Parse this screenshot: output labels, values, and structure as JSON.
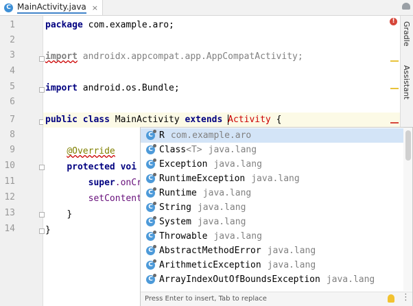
{
  "tab": {
    "icon_letter": "C",
    "name": "MainActivity.java",
    "close": "×"
  },
  "line_numbers": [
    "1",
    "2",
    "3",
    "4",
    "5",
    "6",
    "7",
    "8",
    "9",
    "10",
    "11",
    "12",
    "13",
    "14"
  ],
  "code": {
    "l1_kw": "package",
    "l1_rest": " com.example.aro;",
    "l3_kw": "import",
    "l3_rest": " androidx.appcompat.app.AppCompatActivity;",
    "l5_kw": "import",
    "l5_rest": " android.os.Bundle;",
    "l7_kw1": "public",
    "l7_kw2": "class",
    "l7_name": " MainActivity ",
    "l7_kw3": "extends",
    "l7_err": "Activity",
    "l7_rest": " {",
    "l9_ann": "@Override",
    "l10_kw1": "protected",
    "l10_kw2": "voi",
    "l11_kw": "super",
    "l11_rest": ".onCr",
    "l12_m": "setContent",
    "l13": "}",
    "l14": "}"
  },
  "right_tools": {
    "gradle": "Gradle",
    "assistant": "Assistant"
  },
  "completion": {
    "items": [
      {
        "name": "R",
        "generic": "",
        "pkg": "com.example.aro",
        "selected": true
      },
      {
        "name": "Class",
        "generic": "<T>",
        "pkg": "java.lang",
        "selected": false
      },
      {
        "name": "Exception",
        "generic": "",
        "pkg": "java.lang",
        "selected": false
      },
      {
        "name": "RuntimeException",
        "generic": "",
        "pkg": "java.lang",
        "selected": false
      },
      {
        "name": "Runtime",
        "generic": "",
        "pkg": "java.lang",
        "selected": false
      },
      {
        "name": "String",
        "generic": "",
        "pkg": "java.lang",
        "selected": false
      },
      {
        "name": "System",
        "generic": "",
        "pkg": "java.lang",
        "selected": false
      },
      {
        "name": "Throwable",
        "generic": "",
        "pkg": "java.lang",
        "selected": false
      },
      {
        "name": "AbstractMethodError",
        "generic": "",
        "pkg": "java.lang",
        "selected": false
      },
      {
        "name": "ArithmeticException",
        "generic": "",
        "pkg": "java.lang",
        "selected": false
      },
      {
        "name": "ArrayIndexOutOfBoundsException",
        "generic": "",
        "pkg": "java.lang",
        "selected": false
      }
    ],
    "footer_hint": "Press Enter to insert, Tab to replace",
    "icon_letter": "C"
  },
  "colors": {
    "accent": "#4083c9",
    "selection": "#d3e4f7",
    "error": "#cc0000",
    "keyword": "#000080"
  }
}
